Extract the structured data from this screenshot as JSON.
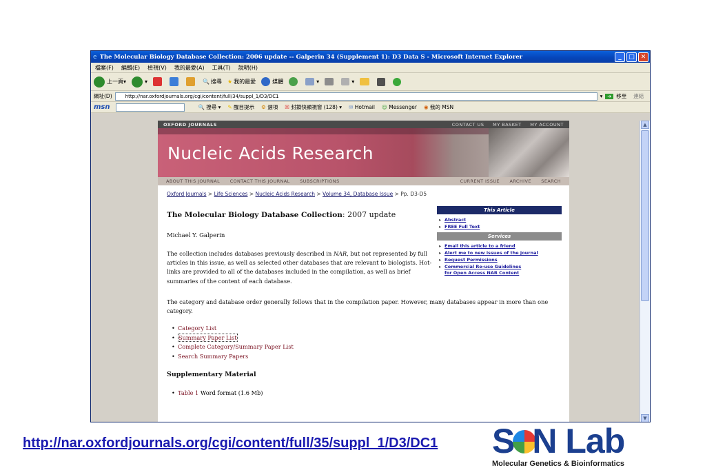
{
  "window": {
    "title": "The Molecular Biology Database Collection: 2006 update -- Galperin 34 (Supplement 1): D3 Data S - Microsoft Internet Explorer",
    "minimize": "_",
    "maximize": "□",
    "close": "✕"
  },
  "menu": [
    "檔案(F)",
    "編輯(E)",
    "檢視(V)",
    "我的最愛(A)",
    "工具(T)",
    "說明(H)"
  ],
  "toolbar": {
    "back": "上一頁",
    "search": "搜尋",
    "favorites": "我的最愛",
    "media": "媒體"
  },
  "address": {
    "label": "網址(D)",
    "url": "http://nar.oxfordjournals.org/cgi/content/full/34/suppl_1/D3/DC1",
    "go": "移至",
    "links": "連結"
  },
  "msnbar": {
    "logo": "msn",
    "search": "搜尋",
    "highlight": "醒目提示",
    "options": "選項",
    "popups": "封鎖快顯視窗 (128)",
    "hotmail": "Hotmail",
    "messenger": "Messenger",
    "mymsn": "我的 MSN"
  },
  "site": {
    "brand": "OXFORD JOURNALS",
    "top_links": [
      "CONTACT US",
      "MY BASKET",
      "MY ACCOUNT"
    ],
    "journal": "Nucleic Acids Research",
    "nav_left": [
      "ABOUT THIS JOURNAL",
      "CONTACT THIS JOURNAL",
      "SUBSCRIPTIONS"
    ],
    "nav_right": [
      "CURRENT ISSUE",
      "ARCHIVE",
      "SEARCH"
    ]
  },
  "breadcrumb": {
    "items": [
      "Oxford Journals",
      "Life Sciences",
      "Nucleic Acids Research",
      "Volume 34, Database Issue"
    ],
    "sep": " > ",
    "tail": "Pp. D3-D5"
  },
  "article": {
    "title_main": "The Molecular Biology Database Collection",
    "title_rest": ": 2007 update",
    "author": "Michael Y. Galperin",
    "para1_a": "The collection includes databases previously described in ",
    "para1_nar": "NAR",
    "para1_b": ", but not represented by full articles in this issue, as well as selected other databases that are relevant to biologists. Hot-links are provided to all of the databases included in the compilation, as well as brief summaries of the content of each database.",
    "para2": "The category and database order generally follows that in the compilation paper. However, many databases appear in more than one category.",
    "links": [
      "Category List",
      "Summary Paper List",
      "Complete Category/Summary Paper List",
      "Search Summary Papers"
    ],
    "supp_heading": "Supplementary Material",
    "supp_link": "Table 1",
    "supp_text": " Word format (1.6 Mb)"
  },
  "sidebar": {
    "this_article": "This Article",
    "article_links": [
      "Abstract",
      "FREE Full Text"
    ],
    "services": "Services",
    "service_links": [
      "Email this article to a friend",
      "Alert me to new issues of the journal",
      "Request Permissions"
    ],
    "commercial_1": "Commercial Re-use Guidelines",
    "commercial_2": "for Open Access NAR Content"
  },
  "footer": {
    "url": "http://nar.oxfordjournals.org/cgi/content/full/35/suppl_1/D3/DC1",
    "logo_a": "S",
    "logo_b": "N Lab",
    "logo_tagline": "Molecular Genetics & Bioinformatics"
  }
}
